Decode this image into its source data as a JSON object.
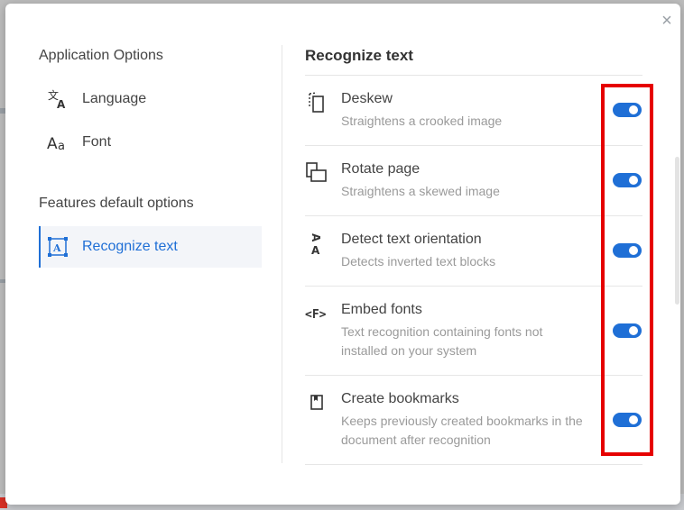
{
  "dialog": {
    "close_symbol": "×"
  },
  "left": {
    "application_section": "Application Options",
    "features_section": "Features default options",
    "items": [
      {
        "label": "Language",
        "icon": "translate-icon"
      },
      {
        "label": "Font",
        "icon": "font-icon"
      },
      {
        "label": "Recognize text",
        "icon": "recognize-text-icon",
        "active": true
      }
    ]
  },
  "right": {
    "title": "Recognize text",
    "options": [
      {
        "title": "Deskew",
        "desc": "Straightens a crooked image",
        "icon": "deskew-icon",
        "enabled": true
      },
      {
        "title": "Rotate page",
        "desc": "Straightens a skewed image",
        "icon": "rotate-page-icon",
        "enabled": true
      },
      {
        "title": "Detect text orientation",
        "desc": "Detects inverted text blocks",
        "icon": "text-orientation-icon",
        "enabled": true
      },
      {
        "title": "Embed fonts",
        "desc": "Text recognition containing fonts not installed on your system",
        "icon": "embed-fonts-icon",
        "enabled": true
      },
      {
        "title": "Create bookmarks",
        "desc": "Keeps previously created bookmarks in the document after recognition",
        "icon": "bookmark-icon",
        "enabled": true
      }
    ]
  },
  "colors": {
    "accent": "#1f6fd6",
    "highlight": "#e60000"
  }
}
